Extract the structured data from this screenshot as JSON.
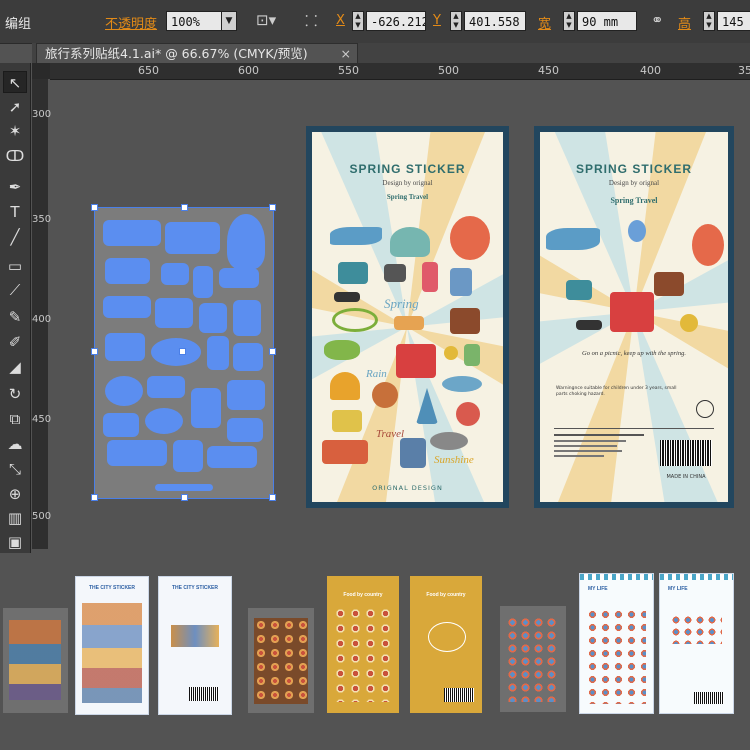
{
  "control_bar": {
    "group_label": "编组",
    "opacity_label": "不透明度",
    "opacity_value": "100%",
    "x_label": "X",
    "x_value": "-626.212",
    "y_label": "Y",
    "y_value": "401.558",
    "width_label": "宽",
    "width_value": "90 mm",
    "height_label": "高",
    "height_value": "145"
  },
  "document_tab": {
    "title": "旅行系列贴纸4.1.ai* @ 66.67% (CMYK/预览)",
    "close_glyph": "×"
  },
  "ruler": {
    "top_labels": [
      "650",
      "600",
      "550",
      "500",
      "450",
      "400",
      "35"
    ],
    "left_labels": [
      "300",
      "350",
      "400",
      "450",
      "500"
    ]
  },
  "tools": [
    "selection-tool",
    "direct-selection-tool",
    "magic-wand-tool",
    "lasso-tool",
    "pen-tool",
    "type-tool",
    "line-tool",
    "rectangle-tool",
    "paintbrush-tool",
    "pencil-tool",
    "blob-brush-tool",
    "eraser-tool",
    "rotate-tool",
    "scale-tool",
    "warp-tool",
    "free-transform-tool",
    "shape-builder-tool",
    "symbol-sprayer-tool",
    "column-graph-tool",
    "artboard-tool"
  ],
  "artboard_front": {
    "title": "SPRING  STICKER",
    "design_by": "Design by orignal",
    "subtitle": "Spring Travel",
    "footer": "ORIGNAL DESIGN",
    "words": [
      "Spring",
      "Rain",
      "Travel",
      "Sunshine"
    ]
  },
  "artboard_back": {
    "title": "SPRING  STICKER",
    "design_by": "Design by orignal",
    "subtitle": "Spring Travel",
    "slogan": "Go on a picnic, keep up with the spring.",
    "warning": "Warningnce suitable for children under 3 years, small parts choking hazard.",
    "made_in": "MADE IN CHINA"
  },
  "thumbnails": [
    {
      "title": "",
      "theme": "city-dark"
    },
    {
      "title": "THE CITY STICKER",
      "theme": "city-front"
    },
    {
      "title": "THE CITY STICKER",
      "theme": "city-back"
    },
    {
      "title": "",
      "theme": "food-dark"
    },
    {
      "title": "Food by country",
      "theme": "food-front"
    },
    {
      "title": "Food by country",
      "theme": "food-back"
    },
    {
      "title": "",
      "theme": "life-dark"
    },
    {
      "title": "MY LIFE",
      "theme": "life-front"
    },
    {
      "title": "MY LIFE",
      "theme": "life-back"
    }
  ],
  "colors": {
    "accent_orange": "#e48b17",
    "selection_blue": "#4a7fe8",
    "artboard_border": "#22465e",
    "ui_dark": "#3c3c3c",
    "canvas": "#535353"
  }
}
